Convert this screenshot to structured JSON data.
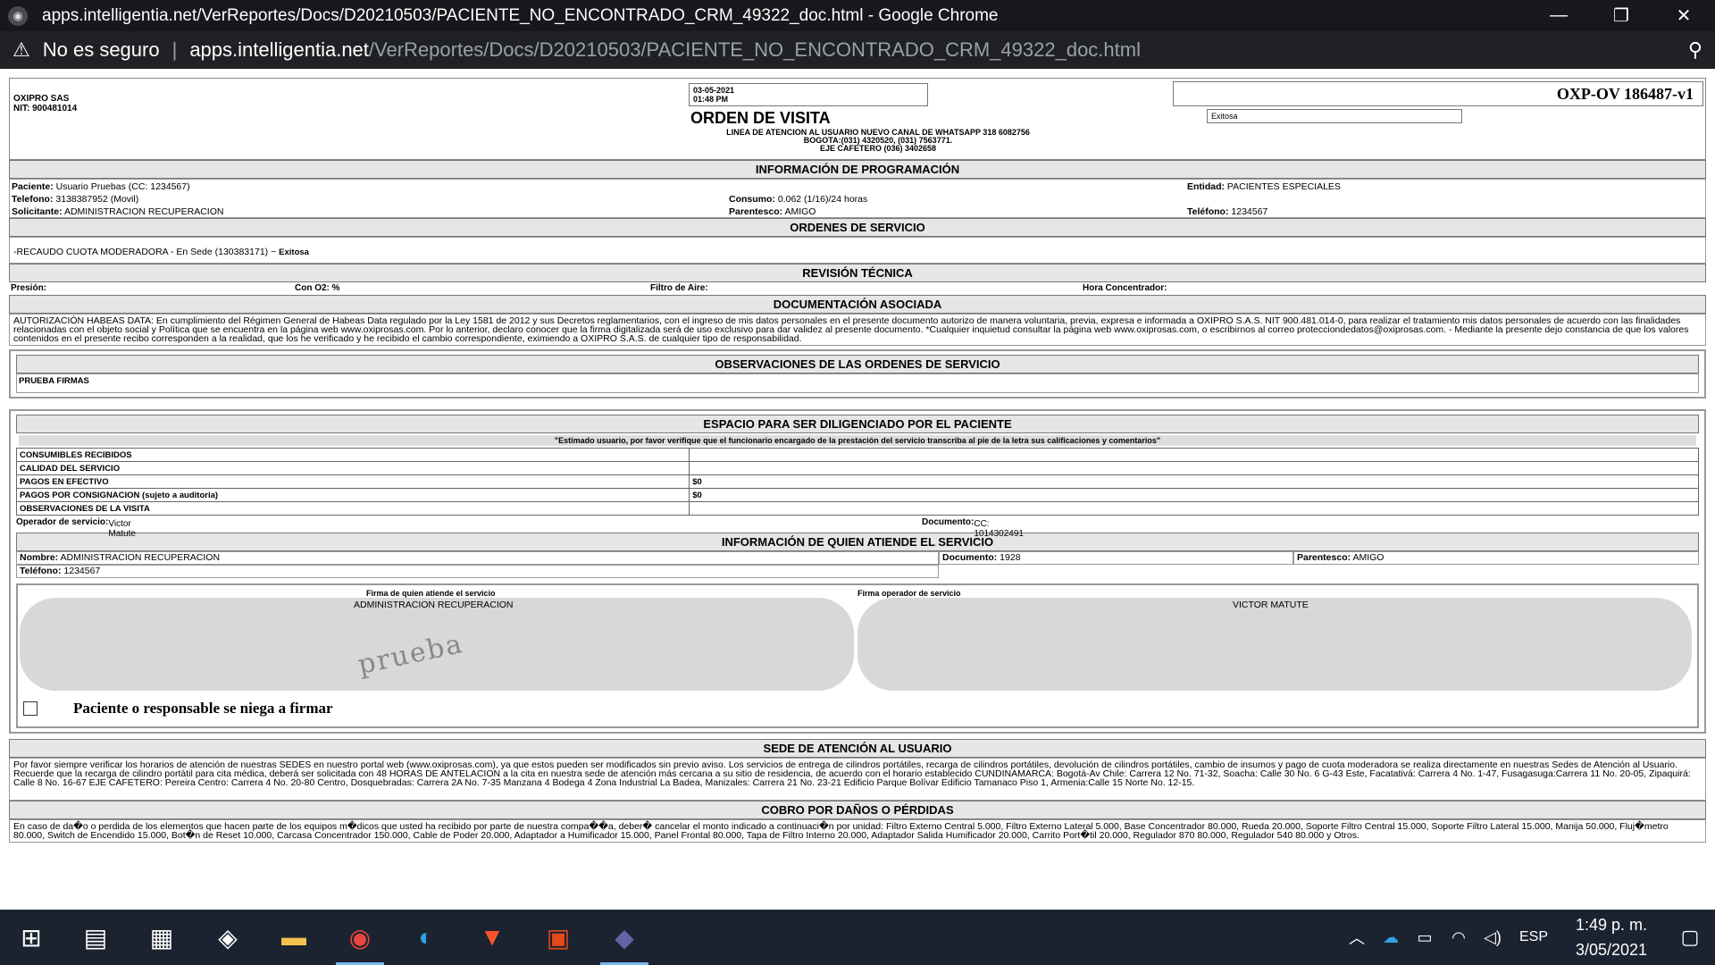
{
  "window": {
    "title": "apps.intelligentia.net/VerReportes/Docs/D20210503/PACIENTE_NO_ENCONTRADO_CRM_49322_doc.html - Google Chrome",
    "minimize": "—",
    "maximize": "❐",
    "close": "✕"
  },
  "address": {
    "warning": "No es seguro",
    "host": "apps.intelligentia.net",
    "path": "/VerReportes/Docs/D20210503/PACIENTE_NO_ENCONTRADO_CRM_49322_doc.html"
  },
  "header": {
    "company": "OXIPRO SAS",
    "nit": "NIT: 900481014",
    "date": "03-05-2021",
    "time": "01:48 PM",
    "title": "ORDEN DE VISITA",
    "line1": "LINEA DE ATENCION AL USUARIO NUEVO CANAL DE WHATSAPP 318 6082756",
    "line2": "BOGOTA:(031) 4320520, (031) 7563771.",
    "line3": "EJE CAFETERO (036) 3402658",
    "code": "OXP-OV 186487-v1",
    "status": "Exitosa"
  },
  "prog": {
    "title": "INFORMACIÓN DE PROGRAMACIÓN",
    "paciente_l": "Paciente:",
    "paciente": "Usuario Pruebas (CC: 1234567)",
    "telefono_l": "Telefono:",
    "telefono": "3138387952 (Movil)",
    "solicitante_l": "Solicitante:",
    "solicitante": "ADMINISTRACION RECUPERACION",
    "consumo_l": "Consumo:",
    "consumo": "0.062 (1/16)/24 horas",
    "parentesco_l": "Parentesco:",
    "parentesco": "AMIGO",
    "entidad_l": "Entidad:",
    "entidad": "PACIENTES ESPECIALES",
    "tel2_l": "Teléfono:",
    "tel2": "1234567"
  },
  "ordenes": {
    "title": "ORDENES DE SERVICIO",
    "item": "-RECAUDO CUOTA MODERADORA - En Sede (130383171)",
    "sep": "~",
    "state": "Exitosa"
  },
  "tecnica": {
    "title": "REVISIÓN TÉCNICA",
    "presion": "Presión:",
    "o2": "Con O2: %",
    "filtro": "Filtro de Aire:",
    "hora": "Hora Concentrador:"
  },
  "docs": {
    "title": "DOCUMENTACIÓN ASOCIADA",
    "text": "AUTORIZACIÓN HABEAS DATA: En cumplimiento del Régimen General de Habeas Data regulado por la Ley 1581 de 2012 y sus Decretos reglamentarios, con el ingreso de mis datos personales en el presente documento autorizo de manera voluntaria, previa, expresa e informada a OXIPRO S.A.S. NIT 900.481.014-0, para realizar el tratamiento mis datos personales de acuerdo con las finalidades relacionadas con el objeto social y Política que se encuentra en la página web www.oxiprosas.com. Por lo anterior, declaro conocer que la firma digitalizada será de uso exclusivo para dar validez al presente documento. *Cualquier inquietud consultar la página web www.oxiprosas.com, o escribirnos al correo protecciondedatos@oxiprosas.com. - Mediante la presente dejo constancia de que los valores contenidos en el presente recibo corresponden a la realidad, que los he verificado y he recibido el cambio correspondiente, eximiendo a OXIPRO S.A.S. de cualquier tipo de responsabilidad."
  },
  "obs": {
    "title": "OBSERVACIONES DE LAS ORDENES DE SERVICIO",
    "text": "PRUEBA FIRMAS"
  },
  "paciente_space": {
    "title": "ESPACIO PARA SER DILIGENCIADO POR EL PACIENTE",
    "note": "\"Estimado usuario, por favor verifique que el funcionario encargado de la prestación del servicio transcriba al pie de la letra sus calificaciones y comentarios\"",
    "rows": [
      {
        "label": "CONSUMIBLES RECIBIDOS",
        "value": ""
      },
      {
        "label": "CALIDAD DEL SERVICIO",
        "value": ""
      },
      {
        "label": "PAGOS EN EFECTIVO",
        "value": "$0"
      },
      {
        "label": "PAGOS POR CONSIGNACION (sujeto a auditoria)",
        "value": "$0"
      },
      {
        "label": "OBSERVACIONES DE LA VISITA",
        "value": ""
      }
    ],
    "operador_l": "Operador de servicio:",
    "operador": "Victor Matute",
    "documento_l": "Documento:",
    "documento": "CC: 1014302491"
  },
  "atiende": {
    "title": "INFORMACIÓN DE QUIEN ATIENDE EL SERVICIO",
    "nombre_l": "Nombre:",
    "nombre": "ADMINISTRACION RECUPERACION",
    "doc_l": "Documento:",
    "doc": "1928",
    "par_l": "Parentesco:",
    "par": "AMIGO",
    "tel_l": "Teléfono:",
    "tel": "1234567"
  },
  "firmas": {
    "left_label": "Firma de quien atiende el servicio",
    "left_name": "ADMINISTRACION RECUPERACION",
    "right_label": "Firma operador de servicio",
    "right_name": "VICTOR MATUTE",
    "scribble": "prueba",
    "refuse": "Paciente o responsable se niega a firmar"
  },
  "sede": {
    "title": "SEDE DE ATENCIÓN AL USUARIO",
    "text": "Por favor siempre verificar los horarios de atención de nuestras SEDES en nuestro portal web (www.oxiprosas.com), ya que estos pueden ser modificados sin previo aviso. Los servicios de entrega de cilindros portátiles, recarga de cilindros portátiles, devolución de cilindros portátiles, cambio de insumos y pago de cuota moderadora se realiza directamente en nuestras Sedes de Atención al Usuario. Recuerde que la recarga de cilindro portátil para cita médica, deberá ser solicitada con 48 HORAS DE ANTELACION a la cita en nuestra sede de atención más cercana a su sitio de residencia, de acuerdo con el horario establecido CUNDINAMARCA: Bogotá-Av Chile: Carrera 12 No. 71-32, Soacha: Calle 30 No. 6 G-43 Este, Facatativá: Carrera 4 No. 1-47, Fusagasuga:Carrera 11 No. 20-05, Zipaquirá: Calle 8 No. 16-67 EJE CAFETERO: Pereira Centro: Carrera 4 No. 20-80 Centro, Dosquebradas: Carrera 2A No. 7-35 Manzana 4 Bodega 4 Zona Industrial La Badea, Manizales: Carrera 21 No. 23-21 Edificio Parque Bolívar Edificio Tamanaco Piso 1, Armenia:Calle 15 Norte No. 12-15."
  },
  "cobro": {
    "title": "COBRO POR DAÑOS O PÉRDIDAS",
    "text": "En caso de da�o o perdida de los elementos que hacen parte de los equipos m�dicos que usted ha recibido por parte de nuestra compa��a, deber� cancelar el monto indicado a continuaci�n por unidad: Filtro Externo Central 5.000, Filtro Externo Lateral 5.000, Base Concentrador 80.000, Rueda 20.000, Soporte Filtro Central 15.000, Soporte Filtro Lateral 15.000, Manija 50.000, Fluj�metro 80.000, Switch de Encendido 15.000, Bot�n de Reset 10.000, Carcasa Concentrador 150.000, Cable de Poder 20.000, Adaptador a Humificador 15.000, Panel Frontal 80.000, Tapa de Filtro Interno 20.000, Adaptador Salida Humificador 20.000, Carrito Port�til 20.000, Regulador 870 80.000, Regulador 540 80.000 y Otros."
  },
  "taskbar": {
    "lang": "ESP",
    "time": "1:49 p. m.",
    "date": "3/05/2021"
  }
}
